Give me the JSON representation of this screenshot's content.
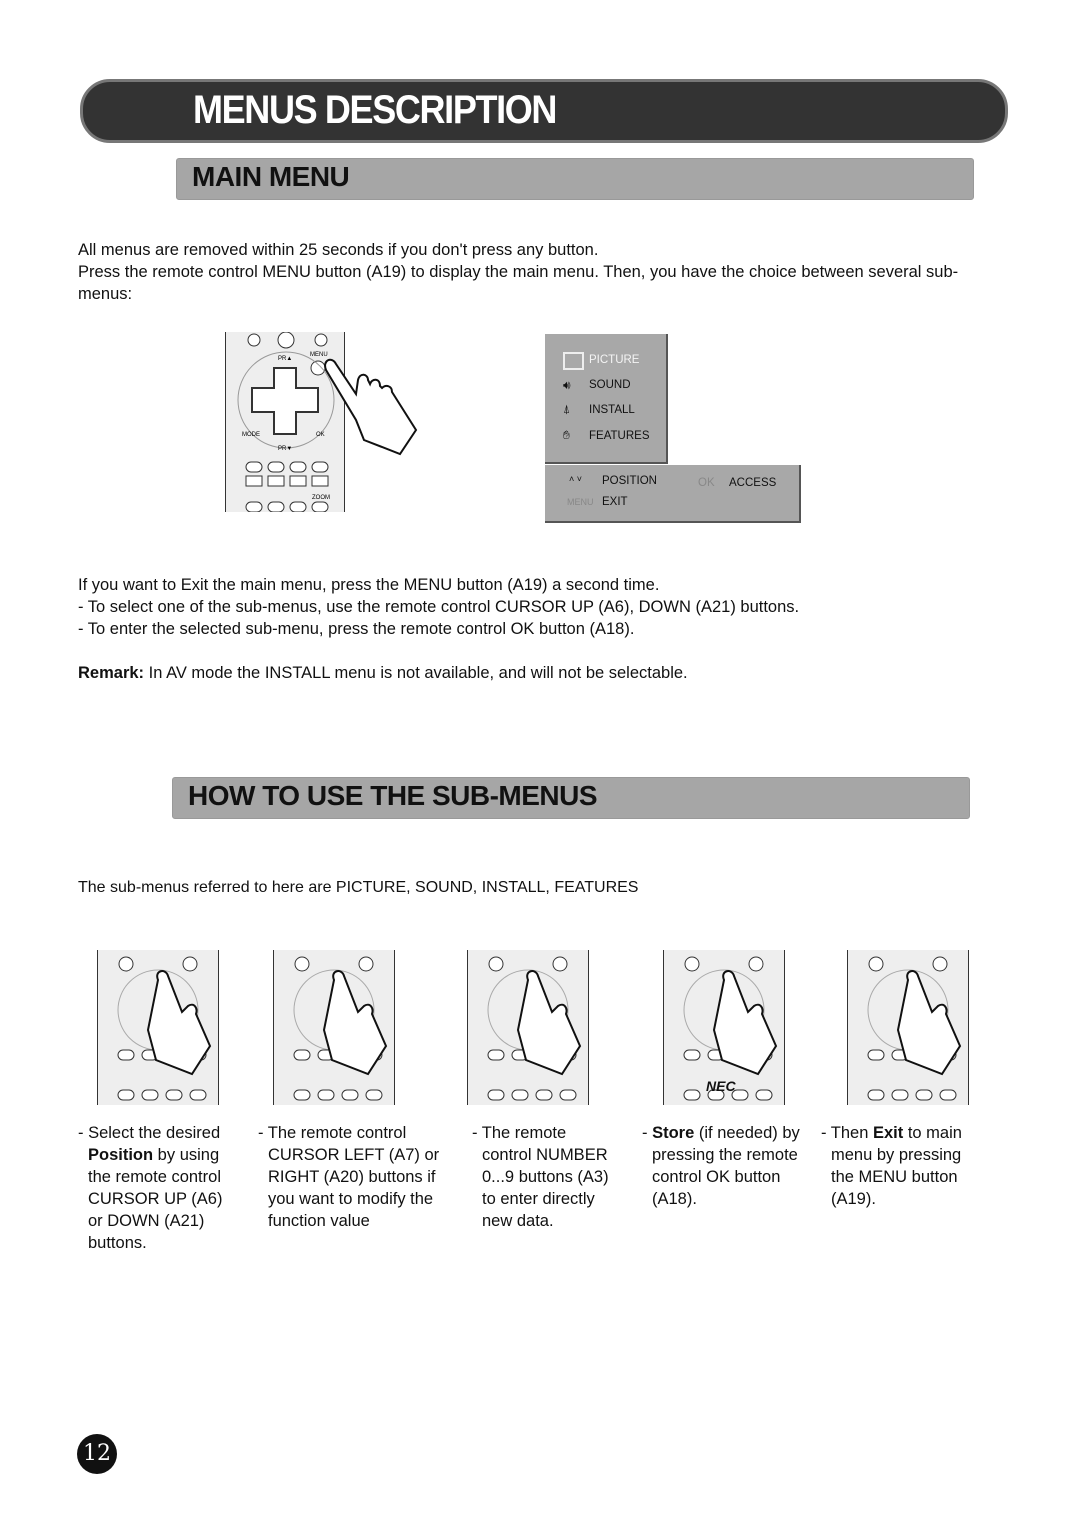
{
  "header": {
    "title": "MENUS DESCRIPTION"
  },
  "main_menu": {
    "heading": "MAIN MENU",
    "intro": [
      "All menus are removed within 25 seconds if you don't press any button.",
      "Press the remote control MENU button (A19) to display the main menu. Then, you have the choice between several sub-menus:"
    ],
    "remote_labels": {
      "pr_up": "PR▲",
      "menu": "MENU",
      "mode": "MODE",
      "ok": "OK",
      "pr_down": "PR▼",
      "zoom": "ZOOM"
    },
    "osd": {
      "items": [
        {
          "label": "PICTURE",
          "icon": "tv-icon",
          "selected": true
        },
        {
          "label": "SOUND",
          "icon": "speaker-icon"
        },
        {
          "label": "INSTALL",
          "icon": "antenna-icon"
        },
        {
          "label": "FEATURES",
          "icon": "hand-remote-icon"
        }
      ],
      "footer": {
        "position_key": "˄ ˅",
        "position_label": "POSITION",
        "ok_key": "OK",
        "access_label": "ACCESS",
        "menu_key": "MENU",
        "exit_label": "EXIT"
      }
    },
    "instructions": [
      "If you want to Exit the main menu, press the MENU button (A19) a second time.",
      "- To select one of the sub-menus, use the remote control CURSOR UP (A6), DOWN (A21) buttons.",
      "- To enter the selected sub-menu, press the remote control OK button (A18)."
    ],
    "remark_label": "Remark:",
    "remark_text": " In AV mode the INSTALL menu is not available, and will not be selectable."
  },
  "sub_menus": {
    "heading": "HOW TO USE THE SUB-MENUS",
    "intro": "The sub-menus referred to here are  PICTURE, SOUND, INSTALL, FEATURES",
    "brand": "NEC",
    "steps": [
      {
        "pre": "- Select the desired ",
        "bold": "Position",
        "post": " by using the remote control CURSOR UP (A6) or DOWN (A21) buttons."
      },
      {
        "pre": "- The remote control CURSOR LEFT (A7) or RIGHT (A20) buttons if you want to modify the function value",
        "bold": "",
        "post": ""
      },
      {
        "pre": "- The remote control NUMBER 0...9 buttons (A3) to enter directly new data.",
        "bold": "",
        "post": ""
      },
      {
        "pre": "- ",
        "bold": "Store",
        "post": " (if needed) by pressing the remote control OK button (A18)."
      },
      {
        "pre": "- Then ",
        "bold": "Exit",
        "post": " to main menu by pressing the MENU button (A19)."
      }
    ]
  },
  "page_number": "12"
}
